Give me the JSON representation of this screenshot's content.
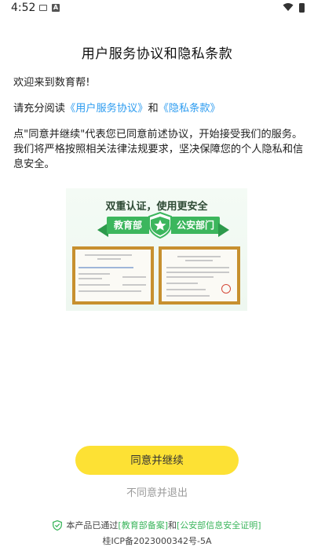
{
  "status_bar": {
    "time": "4:52",
    "notification_letter": "A"
  },
  "title": "用户服务协议和隐私条款",
  "welcome": "欢迎来到数育帮!",
  "read_prefix": "请充分阅读",
  "agreement_link": "《用户服务协议》",
  "and_word": "和",
  "privacy_link": "《隐私条款》",
  "notice_line1": "点\"同意并继续\"代表您已同意前述协议，开始接受我们的服务。",
  "notice_line2": "我们将严格按照相关法律法规要求，坚决保障您的个人隐私和信息安全。",
  "certificate": {
    "heading": "双重认证，使用更安全",
    "left_ribbon": "教育部",
    "right_ribbon": "公安部门"
  },
  "agree_button": "同意并继续",
  "disagree_button": "不同意并退出",
  "footer": {
    "prefix": "本产品已通过",
    "edu_link": "[教育部备案]",
    "and": "和",
    "police_link": "[公安部信息安全证明]",
    "icp": "桂ICP备2023000342号-5A"
  },
  "colors": {
    "accent_yellow": "#fde134",
    "link_blue": "#2d9cf0",
    "brand_green": "#3cb65d"
  }
}
